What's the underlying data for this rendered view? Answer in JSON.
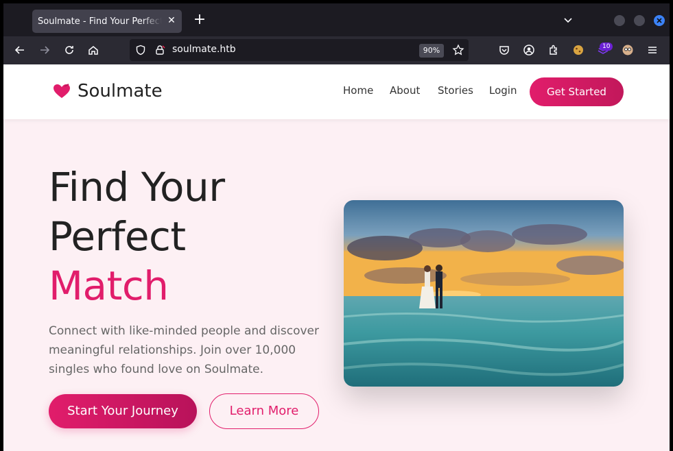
{
  "browser": {
    "tab_title": "Soulmate - Find Your Perfect Match",
    "url": "soulmate.htb",
    "zoom": "90%",
    "extension_badge": "10"
  },
  "site": {
    "brand": "Soulmate",
    "nav": [
      "Home",
      "About",
      "Stories",
      "Login"
    ],
    "cta": "Get Started"
  },
  "hero": {
    "line1": "Find Your",
    "line2": "Perfect",
    "line3": "Match",
    "lead": "Connect with like-minded people and discover meaningful relationships. Join over 10,000 singles who found love on Soulmate.",
    "primary_button": "Start Your Journey",
    "secondary_button": "Learn More"
  },
  "colors": {
    "accent": "#e11d6b",
    "hero_bg": "#fdf0f4"
  },
  "icons": [
    "back-icon",
    "forward-icon",
    "reload-icon",
    "home-icon",
    "shield-icon",
    "lock-icon",
    "star-icon",
    "pocket-icon",
    "account-icon",
    "extensions-icon",
    "menu-icon",
    "heart-icon"
  ]
}
